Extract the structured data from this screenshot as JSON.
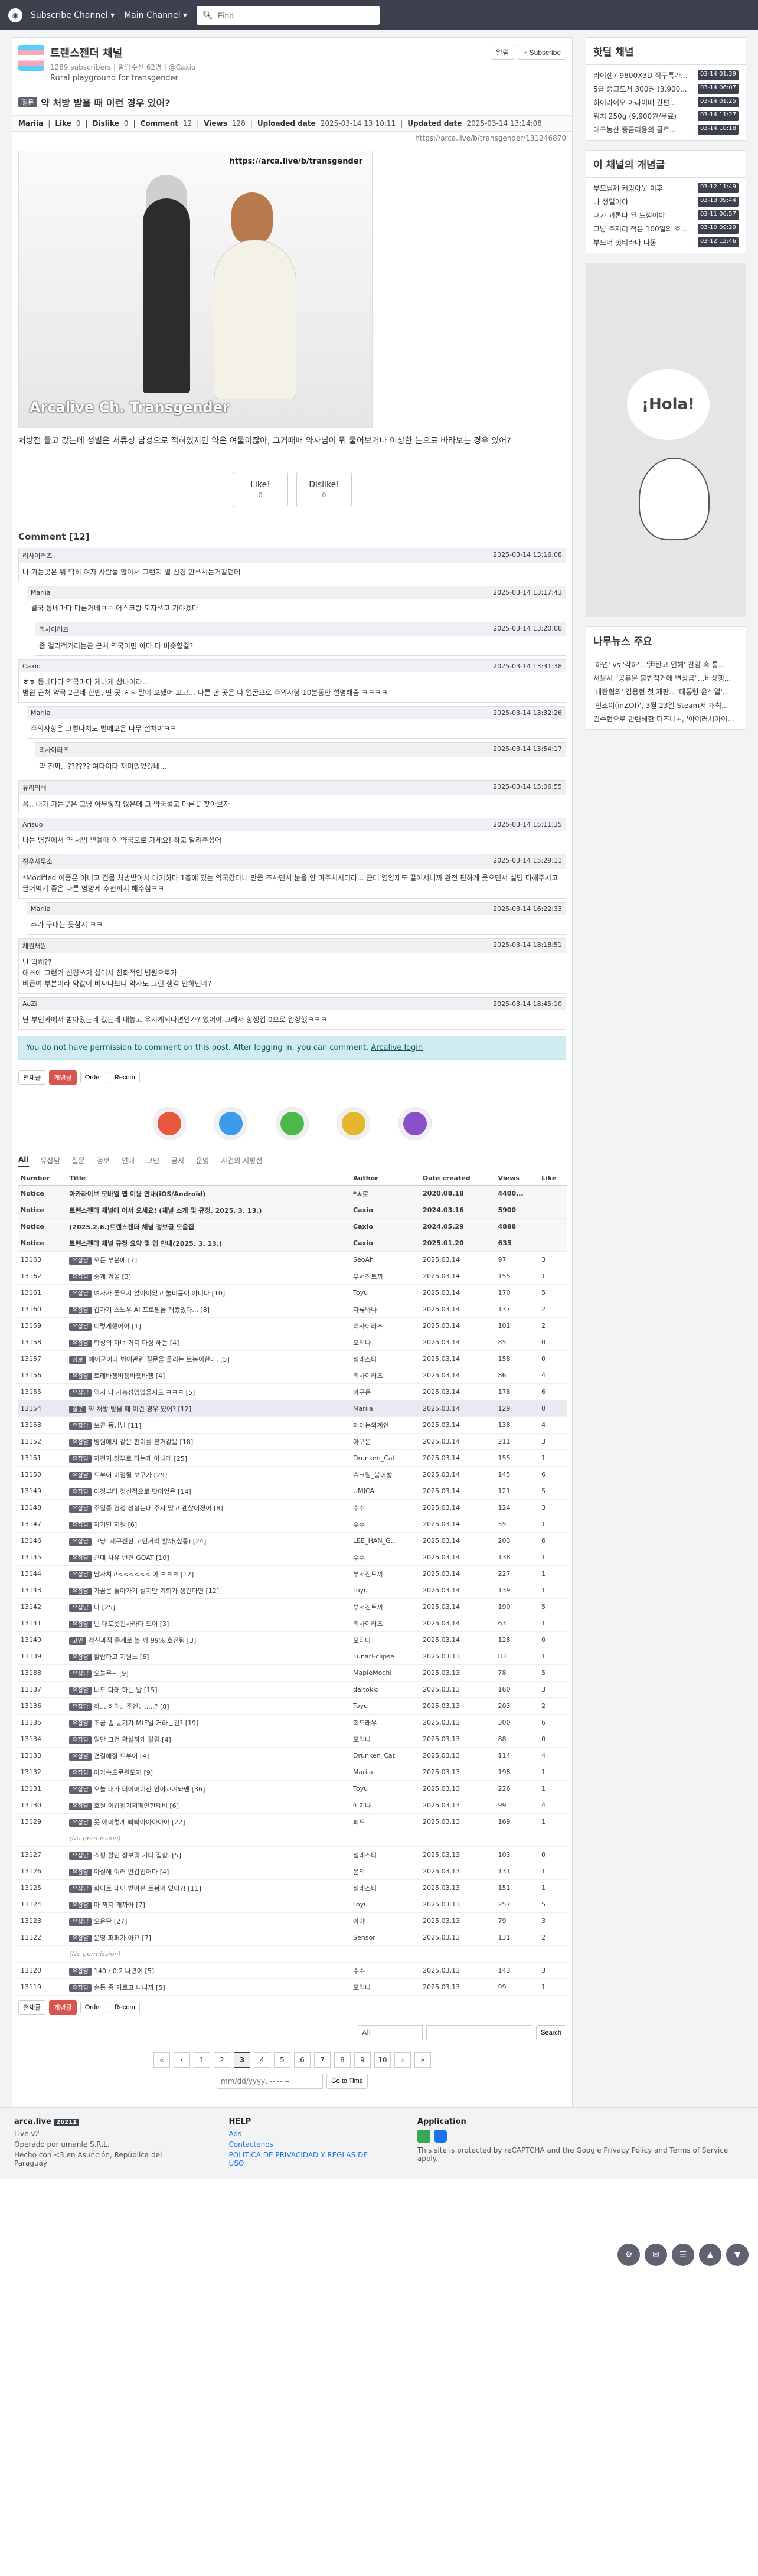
{
  "topbar": {
    "subscribe_label": "Subscribe Channel ▾",
    "main_label": "Main Channel ▾",
    "search_placeholder": "Find"
  },
  "channel": {
    "title": "트랜스젠더 채널",
    "subscribers": "1289 subscribers",
    "notify": "알림수신 62명",
    "owner": "@Caxio",
    "description": "Rural playground for transgender",
    "follow_label": "알림",
    "subscribe_label": "+ Subscribe"
  },
  "post": {
    "badge": "질문",
    "title": "약 처방 받을 때 이런 경우 있어?",
    "author": "Mariia",
    "like_label": "Like",
    "like": "0",
    "dislike_label": "Dislike",
    "dislike": "0",
    "comment_label": "Comment",
    "comment": "12",
    "views_label": "Views",
    "views": "128",
    "uploaded_label": "Uploaded date",
    "uploaded": "2025-03-14 13:10:11",
    "updated_label": "Updated date",
    "updated": "2025-03-14 13:14:08",
    "link": "https://arca.live/b/transgender/131246870",
    "image_watermark_top": "https://arca.live/b/transgender",
    "image_watermark_bottom": "Arcalive Ch. Transgender",
    "body": "처방전 들고 갔는데 성별은 서류상 남성으로 적혀있지만 약은 여물이잖아, 그거때매 약사님이 뭐 물어보거나 이상한 눈으로 바라보는 경우 있어?",
    "vote_like": "Like!",
    "vote_like_sub": "0",
    "vote_dislike": "Dislike!",
    "vote_dislike_sub": "0"
  },
  "comments_header": "Comment [12]",
  "comments": [
    {
      "author": "리사이러츠",
      "time": "2025-03-14 13:16:08",
      "body": "나 가는곳은 뭐 딱히 여자 사람들 많아서 그런지 별 신경 안쓰시는거같던데"
    },
    {
      "author": "Mariia",
      "time": "2025-03-14 13:17:43",
      "body": "결국 동네마다 다른거네ㅋㅋ 어스크랑 모자쓰고 가야겠다"
    },
    {
      "author": "리사이러츠",
      "time": "2025-03-14 13:20:08",
      "body": "좀 걸리적거리는곤 근처 약국이면 아마 다 비슷할걸?"
    },
    {
      "author": "Caxio",
      "time": "2025-03-14 13:31:38",
      "body": "ㅎㅎ 동네마다 약국마다 케바케 상바이라...\n병원 근처 약국 2곤데 한번, 딴 곳 ㅎㅎ 말에 보냈어 보고... 다른 한 곳은 나 얼굴으로 주의사항 10분동안 설명해줌 ㅋㅋㅋㅋ"
    },
    {
      "author": "Mariia",
      "time": "2025-03-14 13:32:26",
      "body": "주의사항은 그렇다쳐도 별에보은 나무 설쳐야ㅋㅋ"
    },
    {
      "author": "리사이러츠",
      "time": "2025-03-14 13:54:17",
      "body": "약 진짜.. ?????? 여다이다 재미있었겠네..."
    },
    {
      "author": "유리의배",
      "time": "2025-03-14 15:06:55",
      "body": "음.. 내가 가는곳은 그냥 아무렇지 않은데 그 약국물고 다른곳 찾아보자"
    },
    {
      "author": "Arisuo",
      "time": "2025-03-14 15:11:35",
      "body": "나는 병원에서 약 처방 받을때 이 약국으로 가세요! 하고 알려주셨어"
    },
    {
      "author": "정우사무소",
      "time": "2025-03-14 15:29:11",
      "body": "*Modified 이중은 아니고 건물 처방받아서 대기하다 1층에 있는 약국갔다니 만큼 조사면서 눈을 안 마주치시더라... 근데 영양제도 끌어서니까 완전 편하게 웃으면서 설명 다해주시고 끌어먹기 좋은 다른 영양제 추천까지 해주심ㅋㅋ"
    },
    {
      "author": "Mariia",
      "time": "2025-03-14 16:22:33",
      "body": "추가 구매는 못참지 ㅋㅋ"
    },
    {
      "author": "채원채원",
      "time": "2025-03-14 18:18:51",
      "body": "난 딱히??\n애초에 그런거 신경쓰기 싫어서 친화적인 병원으로가\n비급여 부분이라 약값이 비싸다보니 약사도 그런 생각 안하던데?"
    },
    {
      "author": "AoZi",
      "time": "2025-03-14 18:45:10",
      "body": "난 부인과에서 받아왔는데 갔는데 대놓고 우지게되나면인가? 있어야 그래서 항생업 0으로 입장했ㅋㅋㅋ"
    }
  ],
  "no_permission_text": "You do not have permission to comment on this post. After logging in, you can comment.",
  "login_link": "Arcalive login",
  "toolbar": {
    "all_label": "전체글",
    "best_label": "개념글",
    "order_label": "Order",
    "recom_label": "Recom"
  },
  "board_tabs": [
    "All",
    "유잡담",
    "질문",
    "정보",
    "연대",
    "고민",
    "공지",
    "운영",
    "사건의 지평선"
  ],
  "table_headers": {
    "number": "Number",
    "title": "Title",
    "author": "Author",
    "date": "Date created",
    "views": "Views",
    "like": "Like"
  },
  "rows": [
    {
      "n": "Notice",
      "cat": "",
      "t": "아카라이브 모바일 앱 이용 안내(iOS/Android)",
      "a": "*ㅊ로",
      "d": "2020.08.18",
      "v": "4400...",
      "l": "",
      "type": "notice"
    },
    {
      "n": "Notice",
      "cat": "",
      "t": "트랜스젠더 채널에 어서 오세요! (채널 소개 및 규정, 2025. 3. 13.)",
      "a": "Caxio",
      "d": "2024.03.16",
      "v": "5900",
      "l": "",
      "type": "notice"
    },
    {
      "n": "Notice",
      "cat": "",
      "t": "(2025.2.6.)트랜스젠더 채널 정보글 모음집",
      "a": "Caxio",
      "d": "2024.05.29",
      "v": "4888",
      "l": "",
      "type": "notice"
    },
    {
      "n": "Notice",
      "cat": "",
      "t": "트랜스젠더 채널 규정 요약 및 앱 안내(2025. 3. 13.)",
      "a": "Caxio",
      "d": "2025.01.20",
      "v": "635",
      "l": "",
      "type": "notice"
    },
    {
      "n": "13163",
      "cat": "유잡담",
      "t": "모든 부분에 [7]",
      "a": "SeoAh",
      "d": "2025.03.14",
      "v": "97",
      "l": "3",
      "type": ""
    },
    {
      "n": "13162",
      "cat": "유잡담",
      "t": "중계 겨울 [3]",
      "a": "부서진토끼",
      "d": "2025.03.14",
      "v": "155",
      "l": "1",
      "type": ""
    },
    {
      "n": "13161",
      "cat": "유잡담",
      "t": "여자가 좋으지 않아야였고 눌비뮨이 아니다 [10]",
      "a": "Toyu",
      "d": "2025.03.14",
      "v": "170",
      "l": "5",
      "type": ""
    },
    {
      "n": "13160",
      "cat": "유잡담",
      "t": "갑자기 스노우 AI 프로필을 해봤었다... [8]",
      "a": "자류봐나",
      "d": "2025.03.14",
      "v": "137",
      "l": "2",
      "type": ""
    },
    {
      "n": "13159",
      "cat": "유잡담",
      "t": "이렇게했어야 [1]",
      "a": "리사이러츠",
      "d": "2025.03.14",
      "v": "101",
      "l": "2",
      "type": ""
    },
    {
      "n": "13158",
      "cat": "유잡담",
      "t": "학성의 자너 거지 마싱 해는 [4]",
      "a": "모리나",
      "d": "2025.03.14",
      "v": "85",
      "l": "0",
      "type": ""
    },
    {
      "n": "13157",
      "cat": "정보",
      "t": "에어군이나 병예관련 질문을 올리는 트붕이한테. [5]",
      "a": "설레스타",
      "d": "2025.03.14",
      "v": "158",
      "l": "0",
      "type": ""
    },
    {
      "n": "13156",
      "cat": "유잡담",
      "t": "트레바쟁바쟁바잿바쟁 [4]",
      "a": "리사이러츠",
      "d": "2025.03.14",
      "v": "86",
      "l": "4",
      "type": ""
    },
    {
      "n": "13155",
      "cat": "유잡담",
      "t": "역시 나 가능성있었을지도 ㅋㅋㅋ [5]",
      "a": "아구운",
      "d": "2025.03.14",
      "v": "178",
      "l": "6",
      "type": ""
    },
    {
      "n": "13154",
      "cat": "질문",
      "t": "약 처방 받을 때 이런 경우 있어? [12]",
      "a": "Mariia",
      "d": "2025.03.14",
      "v": "129",
      "l": "0",
      "type": "hl"
    },
    {
      "n": "13153",
      "cat": "유잡담",
      "t": "보꾼 동남남 [11]",
      "a": "페미는외계인",
      "d": "2025.03.14",
      "v": "138",
      "l": "4",
      "type": ""
    },
    {
      "n": "13152",
      "cat": "유잡담",
      "t": "병원에서 같은 편이를 본거같음 [18]",
      "a": "아구운",
      "d": "2025.03.14",
      "v": "211",
      "l": "3",
      "type": ""
    },
    {
      "n": "13151",
      "cat": "유잡담",
      "t": "자전거 창부로 타는게 아니래 [25]",
      "a": "Drunken_Cat",
      "d": "2025.03.14",
      "v": "155",
      "l": "1",
      "type": ""
    },
    {
      "n": "13150",
      "cat": "유잡담",
      "t": "트부어 이점될 보구가 [29]",
      "a": "슈크림_붕어빵",
      "d": "2025.03.14",
      "v": "145",
      "l": "6",
      "type": ""
    },
    {
      "n": "13149",
      "cat": "유잡담",
      "t": "이정부터 정신적으로 닷어었은 [14]",
      "a": "UMJCA",
      "d": "2025.03.14",
      "v": "121",
      "l": "5",
      "type": ""
    },
    {
      "n": "13148",
      "cat": "유잡담",
      "t": "주일중 영정 성형는대 주사 맞고 괜찮어졌어 [8]",
      "a": "수수",
      "d": "2025.03.14",
      "v": "124",
      "l": "3",
      "type": ""
    },
    {
      "n": "13147",
      "cat": "유잡담",
      "t": "자기면 지원 [6]",
      "a": "수수",
      "d": "2025.03.14",
      "v": "55",
      "l": "1",
      "type": ""
    },
    {
      "n": "13146",
      "cat": "유잡담",
      "t": "그냥..제구전한 고민거리 할까(싶통) [24]",
      "a": "LEE_HAN_G...",
      "d": "2025.03.14",
      "v": "203",
      "l": "6",
      "type": ""
    },
    {
      "n": "13145",
      "cat": "유잡담",
      "t": "근대 사유 번견 GOAT [10]",
      "a": "수수",
      "d": "2025.03.14",
      "v": "138",
      "l": "1",
      "type": ""
    },
    {
      "n": "13144",
      "cat": "유잡담",
      "t": "남자치고<<<<<< 야 ㅋㅋㅋ [12]",
      "a": "부서진토끼",
      "d": "2025.03.14",
      "v": "227",
      "l": "1",
      "type": ""
    },
    {
      "n": "13143",
      "cat": "유잡담",
      "t": "가끔은 돌아가기 실지만 기회가 생긴다면 [12]",
      "a": "Toyu",
      "d": "2025.03.14",
      "v": "139",
      "l": "1",
      "type": ""
    },
    {
      "n": "13142",
      "cat": "유잡담",
      "t": "나 [25]",
      "a": "부서진토끼",
      "d": "2025.03.14",
      "v": "190",
      "l": "5",
      "type": ""
    },
    {
      "n": "13141",
      "cat": "유잡담",
      "t": "넌 대포웃긴사라다 드어 [3]",
      "a": "리사이러츠",
      "d": "2025.03.14",
      "v": "63",
      "l": "1",
      "type": ""
    },
    {
      "n": "13140",
      "cat": "고민",
      "t": "정신과적 증세로 볼 께 99% 호전됨 [3]",
      "a": "모리나",
      "d": "2025.03.14",
      "v": "128",
      "l": "0",
      "type": ""
    },
    {
      "n": "13139",
      "cat": "유잡담",
      "t": "할랍하고 지원노 [6]",
      "a": "LunarEclipse",
      "d": "2025.03.13",
      "v": "83",
      "l": "1",
      "type": ""
    },
    {
      "n": "13138",
      "cat": "유잡담",
      "t": "오늘은~ [9]",
      "a": "MapleMochi",
      "d": "2025.03.13",
      "v": "78",
      "l": "5",
      "type": ""
    },
    {
      "n": "13137",
      "cat": "유잡담",
      "t": "너도 다래 하는 날 [15]",
      "a": "daltokki",
      "d": "2025.03.13",
      "v": "160",
      "l": "3",
      "type": ""
    },
    {
      "n": "13136",
      "cat": "유잡담",
      "t": "하... 허억.. 주인님.....? [8]",
      "a": "Toyu",
      "d": "2025.03.13",
      "v": "203",
      "l": "2",
      "type": ""
    },
    {
      "n": "13135",
      "cat": "유잡담",
      "t": "조금 좀 동기가 MtF일 거라는건? [19]",
      "a": "회드래유",
      "d": "2025.03.13",
      "v": "300",
      "l": "6",
      "type": ""
    },
    {
      "n": "13134",
      "cat": "유잡담",
      "t": "얼단 그건 확실하게 갈림 [4]",
      "a": "모리나",
      "d": "2025.03.13",
      "v": "88",
      "l": "0",
      "type": ""
    },
    {
      "n": "13133",
      "cat": "유잡담",
      "t": "견결해질 트부어 [4]",
      "a": "Drunken_Cat",
      "d": "2025.03.13",
      "v": "114",
      "l": "4",
      "type": ""
    },
    {
      "n": "13132",
      "cat": "유잡담",
      "t": "아가속도문원도지 [9]",
      "a": "Mariia",
      "d": "2025.03.13",
      "v": "198",
      "l": "1",
      "type": ""
    },
    {
      "n": "13131",
      "cat": "유잡담",
      "t": "오늘 내가 더이머이산 안야교겨놔맨 [36]",
      "a": "Toyu",
      "d": "2025.03.13",
      "v": "226",
      "l": "1",
      "type": ""
    },
    {
      "n": "13130",
      "cat": "유잡담",
      "t": "호원 이갑정기획페인한테비 [6]",
      "a": "예지나",
      "d": "2025.03.13",
      "v": "99",
      "l": "4",
      "type": ""
    },
    {
      "n": "13129",
      "cat": "유잡담",
      "t": "못 애미렇게 빠빠아아아아아 [22]",
      "a": "피드",
      "d": "2025.03.13",
      "v": "169",
      "l": "1",
      "type": ""
    },
    {
      "n": "",
      "cat": "",
      "t": "(No permission)",
      "a": "",
      "d": "",
      "v": "",
      "l": "",
      "type": "noperm"
    },
    {
      "n": "13127",
      "cat": "유잡담",
      "t": "쇼핑 할인 정보및 기타 집합. [5]",
      "a": "설레스타",
      "d": "2025.03.13",
      "v": "103",
      "l": "0",
      "type": ""
    },
    {
      "n": "13126",
      "cat": "유잡담",
      "t": "아실해 여러 반갑업어다 [4]",
      "a": "윤의",
      "d": "2025.03.13",
      "v": "131",
      "l": "1",
      "type": ""
    },
    {
      "n": "13125",
      "cat": "유잡담",
      "t": "화이트 데이 받아본 트붕이 있어?! [11]",
      "a": "설레스타",
      "d": "2025.03.13",
      "v": "151",
      "l": "1",
      "type": ""
    },
    {
      "n": "13124",
      "cat": "유잡담",
      "t": "아 꺼져 개까아 [7]",
      "a": "Toyu",
      "d": "2025.03.13",
      "v": "257",
      "l": "5",
      "type": ""
    },
    {
      "n": "13123",
      "cat": "유잡담",
      "t": "오운완 [27]",
      "a": "아야",
      "d": "2025.03.13",
      "v": "79",
      "l": "3",
      "type": ""
    },
    {
      "n": "13122",
      "cat": "유잡담",
      "t": "운영 퍼퍼가 아요 [7]",
      "a": "Sensor",
      "d": "2025.03.13",
      "v": "131",
      "l": "2",
      "type": ""
    },
    {
      "n": "",
      "cat": "",
      "t": "(No permission)",
      "a": "",
      "d": "",
      "v": "",
      "l": "",
      "type": "noperm"
    },
    {
      "n": "13120",
      "cat": "유잡담",
      "t": "140 / 0.2 나왔어 [5]",
      "a": "수수",
      "d": "2025.03.13",
      "v": "143",
      "l": "3",
      "type": ""
    },
    {
      "n": "13119",
      "cat": "유잡담",
      "t": "손톱 좀 기르고 니니까 [5]",
      "a": "모리나",
      "d": "2025.03.13",
      "v": "99",
      "l": "1",
      "type": ""
    }
  ],
  "pages": [
    "«",
    "‹",
    "1",
    "2",
    "3",
    "4",
    "5",
    "6",
    "7",
    "8",
    "9",
    "10",
    "›",
    "»"
  ],
  "current_page": "3",
  "search_scope": "All",
  "search_button": "Search",
  "date_placeholder": "mm/dd/yyyy, --:-- --",
  "goto_label": "Go to Time",
  "side": {
    "hot_title": "핫딜 채널",
    "hot": [
      {
        "t": "라이젠7 9800X3D 직구특가...",
        "time": "03-14 01:39"
      },
      {
        "t": "5급 중고도서 300권 (3,900...",
        "time": "03-14 06:07"
      },
      {
        "t": "하이라이오 아라이메 간편...",
        "time": "03-14 01:25"
      },
      {
        "t": "워치 250g (9,900원/무료)",
        "time": "03-14 11:27"
      },
      {
        "t": "대구농산 중금리용의 콜로...",
        "time": "03-14 10:18"
      }
    ],
    "best_title": "이 채널의 개념글",
    "best": [
      {
        "t": "부모님께 커밍아웃 이후",
        "time": "03-12 11:49"
      },
      {
        "t": "나 생일이야",
        "time": "03-13 09:44"
      },
      {
        "t": "내가 괴롭다 된 느낌이야",
        "time": "03-11 06:57"
      },
      {
        "t": "그냥 주저리 적은 100일의 호...",
        "time": "03-10 09:29"
      },
      {
        "t": "부모더 헛티라마 다동",
        "time": "03-12 12:46"
      }
    ],
    "ad_text": "¡Hola!",
    "news_title": "나무뉴스 주요",
    "news": [
      "'하면' vs '각하'...'尹탄고 인해' 찬양 속 통...",
      "서울시 \"공유문 불법점거에 변상금\"...비상행...",
      "'내란혐의' 김용현 첫 재판...\"대통령 윤석열'...",
      "'인조이(inZOI)', 3월 23일 Steam서 개최...",
      "김수현으로 관련해한 디즈니+, '아이러시아이..."
    ]
  },
  "footer": {
    "brand": "arca.live",
    "brand_count": "26211",
    "version": "Live v2",
    "op": "Operado por umanle S.R.L.",
    "made": "Hecho con <3 en Asunción, República del Paraguay",
    "help_title": "HELP",
    "help_links": [
      "Ads",
      "Contactenos",
      "POLITICA DE PRIVACIDAD Y REGLAS DE USO"
    ],
    "app_title": "Application",
    "recaptcha": "This site is protected by reCAPTCHA and the Google Privacy Policy and Terms of Service apply."
  }
}
